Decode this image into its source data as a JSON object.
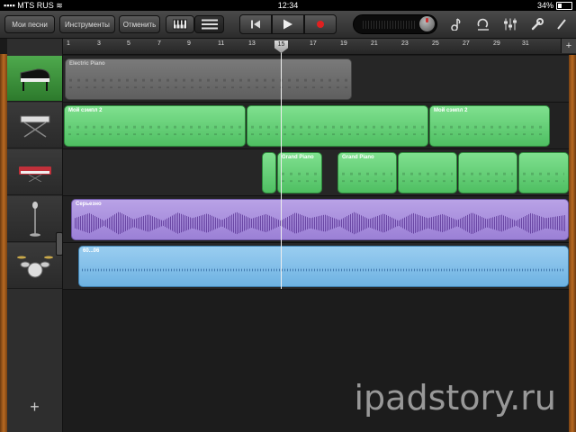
{
  "status": {
    "carrier": "MTS RUS",
    "time": "12:34",
    "battery": "34%"
  },
  "toolbar": {
    "my_songs": "Мои песни",
    "instruments": "Инструменты",
    "undo": "Отменить",
    "view_keyboard_icon": "piano-keys-icon",
    "view_tracks_icon": "tracks-list-icon",
    "rewind_icon": "skip-to-start-icon",
    "play_icon": "play-icon",
    "record_icon": "record-icon",
    "metronome_icon": "metronome-icon",
    "loop_icon": "loop-icon",
    "mixer_icon": "mixer-icon",
    "settings_icon": "wrench-icon",
    "record_color": "#e02020"
  },
  "ruler": {
    "bars": [
      "1",
      "3",
      "5",
      "7",
      "9",
      "11",
      "13",
      "15",
      "17",
      "19",
      "21",
      "23",
      "25",
      "27",
      "29",
      "31"
    ],
    "playhead_bar": "15",
    "add_section": "+"
  },
  "tracks": [
    {
      "instrument": "grand-piano",
      "selected": true,
      "regions": [
        {
          "name": "Electric Piano",
          "style": "grey"
        }
      ]
    },
    {
      "instrument": "keyboard-stand",
      "selected": false,
      "regions": [
        {
          "name": "Мой сэмпл 2",
          "style": "green"
        },
        {
          "name": "",
          "style": "green"
        },
        {
          "name": "Мой сэмпл 2",
          "style": "green"
        }
      ]
    },
    {
      "instrument": "synth-keyboard",
      "selected": false,
      "regions": [
        {
          "name": "",
          "style": "green"
        },
        {
          "name": "Grand Piano",
          "style": "green"
        },
        {
          "name": "Grand Piano",
          "style": "green"
        },
        {
          "name": "",
          "style": "green"
        },
        {
          "name": "",
          "style": "green"
        },
        {
          "name": "",
          "style": "green"
        }
      ]
    },
    {
      "instrument": "microphone",
      "selected": false,
      "regions": [
        {
          "name": "Серьезно",
          "style": "purple"
        }
      ]
    },
    {
      "instrument": "drum-kit",
      "selected": false,
      "regions": [
        {
          "name": "60...06",
          "style": "blue"
        }
      ]
    }
  ],
  "add_track": "+",
  "watermark": "ipadstory.ru"
}
